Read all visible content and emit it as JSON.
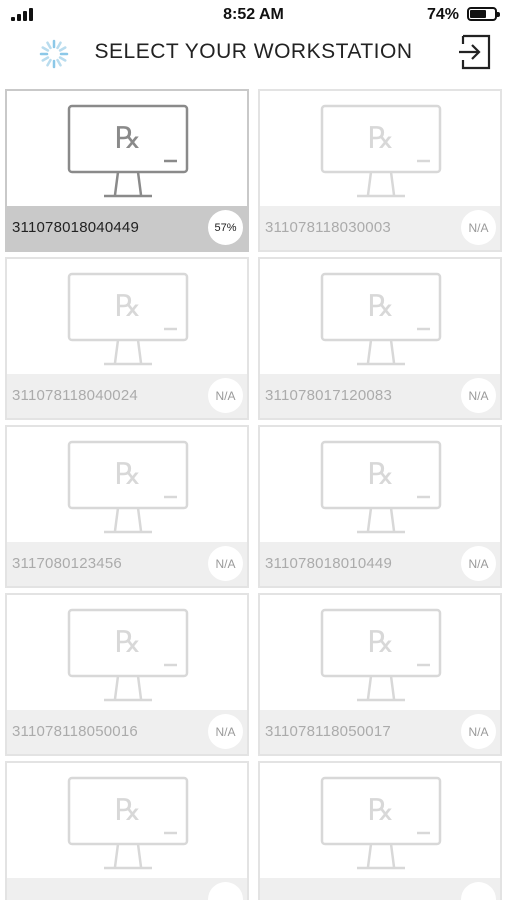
{
  "status_bar": {
    "time": "8:52 AM",
    "battery_percent": "74%",
    "battery_level": 0.74,
    "signal_bars": 4
  },
  "header": {
    "title": "SELECT YOUR WORKSTATION",
    "loading_icon": "spinner-icon",
    "logout_icon": "logout-icon"
  },
  "workstation_icon": {
    "name": "monitor-icon",
    "glyph": "℞"
  },
  "workstations": [
    {
      "serial": "311078018040449",
      "status": "57%",
      "selected": true
    },
    {
      "serial": "311078118030003",
      "status": "N/A",
      "selected": false
    },
    {
      "serial": "311078118040024",
      "status": "N/A",
      "selected": false
    },
    {
      "serial": "311078017120083",
      "status": "N/A",
      "selected": false
    },
    {
      "serial": "3117080123456",
      "status": "N/A",
      "selected": false
    },
    {
      "serial": "311078018010449",
      "status": "N/A",
      "selected": false
    },
    {
      "serial": "311078118050016",
      "status": "N/A",
      "selected": false
    },
    {
      "serial": "311078118050017",
      "status": "N/A",
      "selected": false
    },
    {
      "serial": "",
      "status": "",
      "selected": false
    },
    {
      "serial": "",
      "status": "",
      "selected": false
    }
  ],
  "colors": {
    "selected_bar": "#c9c9c9",
    "unselected_bar": "#efefef",
    "selected_icon": "#8a8a8a",
    "unselected_icon": "#d8d8d8"
  }
}
